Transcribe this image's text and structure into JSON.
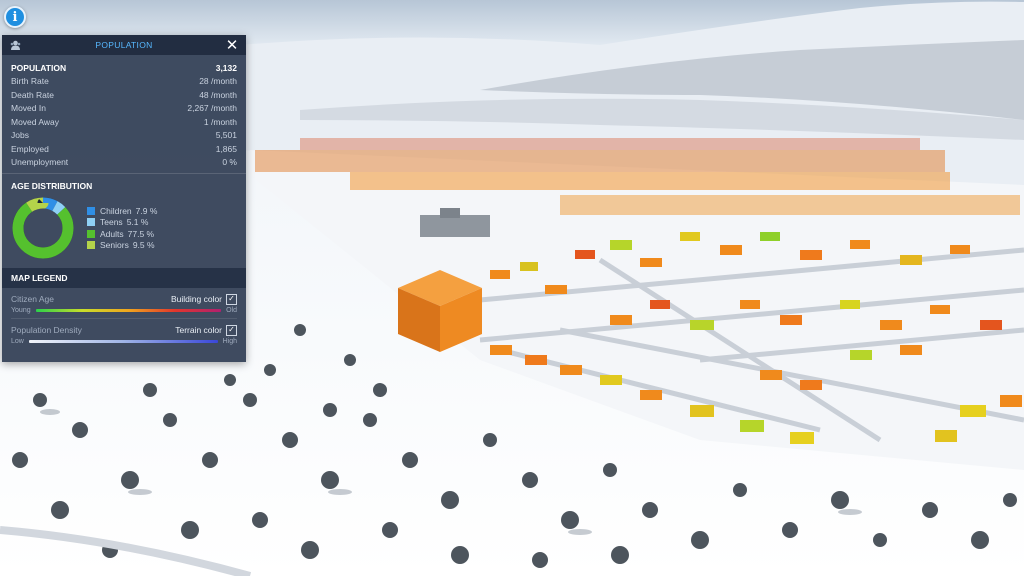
{
  "panel": {
    "title": "POPULATION",
    "close_glyph": "✕",
    "stats": [
      {
        "label": "POPULATION",
        "value": "3,132"
      },
      {
        "label": "Birth Rate",
        "value": "28 /month"
      },
      {
        "label": "Death Rate",
        "value": "48 /month"
      },
      {
        "label": "Moved In",
        "value": "2,267 /month"
      },
      {
        "label": "Moved Away",
        "value": "1 /month"
      },
      {
        "label": "Jobs",
        "value": "5,501"
      },
      {
        "label": "Employed",
        "value": "1,865"
      },
      {
        "label": "Unemployment",
        "value": "0 %"
      }
    ],
    "age_distribution": {
      "title": "AGE DISTRIBUTION",
      "groups": [
        {
          "label": "Children",
          "value": "7.9 %",
          "percent": 7.9,
          "color": "#2f8fe6"
        },
        {
          "label": "Teens",
          "value": "5.1 %",
          "percent": 5.1,
          "color": "#8fd0f5"
        },
        {
          "label": "Adults",
          "value": "77.5 %",
          "percent": 77.5,
          "color": "#55c12e"
        },
        {
          "label": "Seniors",
          "value": "9.5 %",
          "percent": 9.5,
          "color": "#b4d34a"
        }
      ]
    },
    "map_legend": {
      "title": "MAP LEGEND",
      "citizen_age": {
        "label": "Citizen Age",
        "toggle_label": "Building color",
        "checked": true,
        "low": "Young",
        "high": "Old"
      },
      "population_density": {
        "label": "Population Density",
        "toggle_label": "Terrain color",
        "checked": true,
        "low": "Low",
        "high": "High"
      }
    }
  },
  "info_button": {
    "glyph": "i"
  },
  "colors": {
    "accent": "#57b8ff",
    "panel_bg": "#303d54",
    "building_orange": "#f08a1c"
  }
}
